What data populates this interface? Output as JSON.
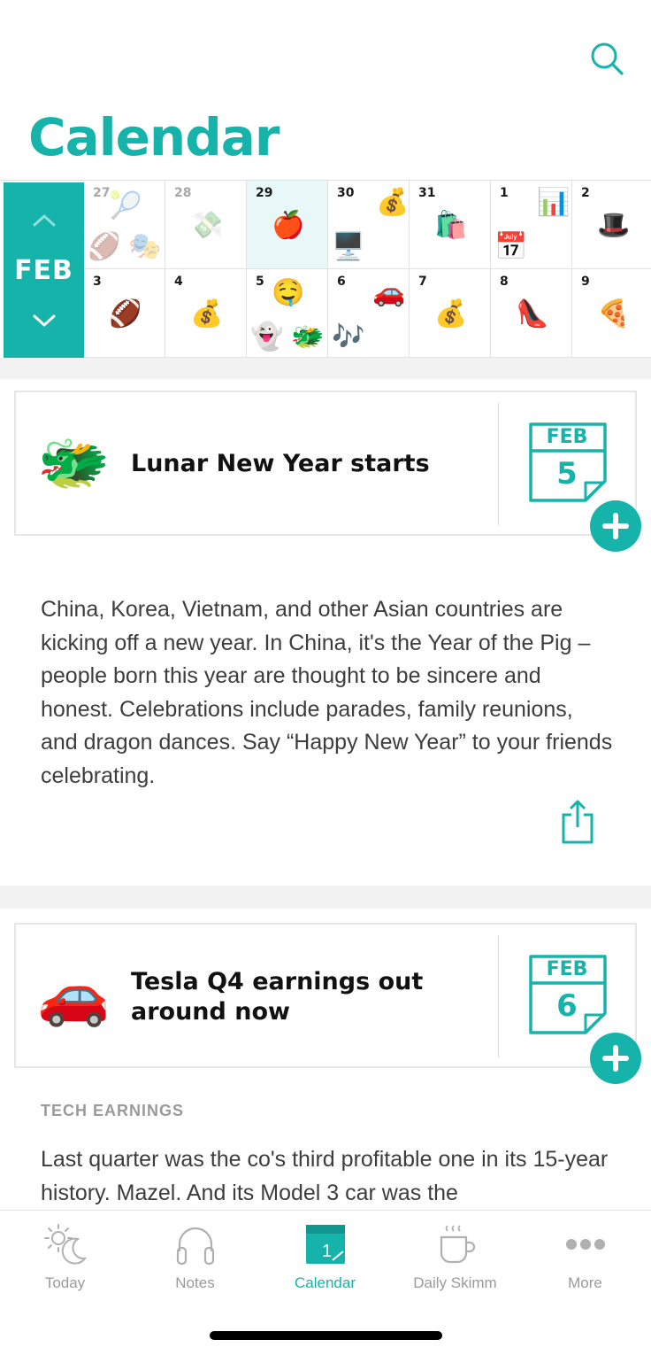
{
  "header": {
    "title": "Calendar"
  },
  "calendar": {
    "month": "FEB",
    "weeks": [
      [
        {
          "day": "27",
          "emojis": [
            "🎾",
            "🏈",
            "🎭"
          ],
          "state": "past"
        },
        {
          "day": "28",
          "emojis": [
            "💸"
          ],
          "state": "past"
        },
        {
          "day": "29",
          "emojis": [
            "🍎"
          ],
          "state": "today"
        },
        {
          "day": "30",
          "emojis": [
            "💰",
            "🖥️"
          ],
          "state": "normal"
        },
        {
          "day": "31",
          "emojis": [
            "🛍️"
          ],
          "state": "normal"
        },
        {
          "day": "1",
          "emojis": [
            "📊",
            "📅"
          ],
          "state": "normal"
        },
        {
          "day": "2",
          "emojis": [
            "🎩"
          ],
          "state": "normal"
        }
      ],
      [
        {
          "day": "3",
          "emojis": [
            "🏈"
          ],
          "state": "normal"
        },
        {
          "day": "4",
          "emojis": [
            "💰"
          ],
          "state": "normal"
        },
        {
          "day": "5",
          "emojis": [
            "🤤",
            "👻",
            "🐲"
          ],
          "state": "normal"
        },
        {
          "day": "6",
          "emojis": [
            "🚗",
            "🎶"
          ],
          "state": "normal"
        },
        {
          "day": "7",
          "emojis": [
            "💰"
          ],
          "state": "normal"
        },
        {
          "day": "8",
          "emojis": [
            "👠"
          ],
          "state": "normal"
        },
        {
          "day": "9",
          "emojis": [
            "🍕"
          ],
          "state": "normal"
        }
      ]
    ]
  },
  "events": [
    {
      "emoji": "🐲",
      "title": "Lunar New Year starts",
      "badge_month": "FEB",
      "badge_day": "5",
      "category": "",
      "description": "China, Korea, Vietnam, and other Asian countries are kicking off a new year. In China, it's the Year of the Pig –people born this year are thought to be sincere and honest. Celebrations include parades, family reunions, and dragon dances. Say “Happy New Year” to your friends celebrating."
    },
    {
      "emoji": "🚗",
      "title": "Tesla Q4 earnings out around now",
      "badge_month": "FEB",
      "badge_day": "6",
      "category": "TECH EARNINGS",
      "description": "Last quarter was the co's third profitable one in its 15-year history. Mazel. And its Model 3 car was the"
    }
  ],
  "tabbar": {
    "tabs": [
      {
        "label": "Today",
        "icon": "sun-moon-icon",
        "active": false
      },
      {
        "label": "Notes",
        "icon": "headphones-icon",
        "active": false
      },
      {
        "label": "Calendar",
        "icon": "calendar-icon",
        "active": true
      },
      {
        "label": "Daily Skimm",
        "icon": "coffee-cup-icon",
        "active": false
      },
      {
        "label": "More",
        "icon": "more-dots-icon",
        "active": false
      }
    ]
  },
  "colors": {
    "accent": "#16b3ab",
    "tab_inactive": "#9a9a9a",
    "today_highlight": "#e8f7f8"
  }
}
